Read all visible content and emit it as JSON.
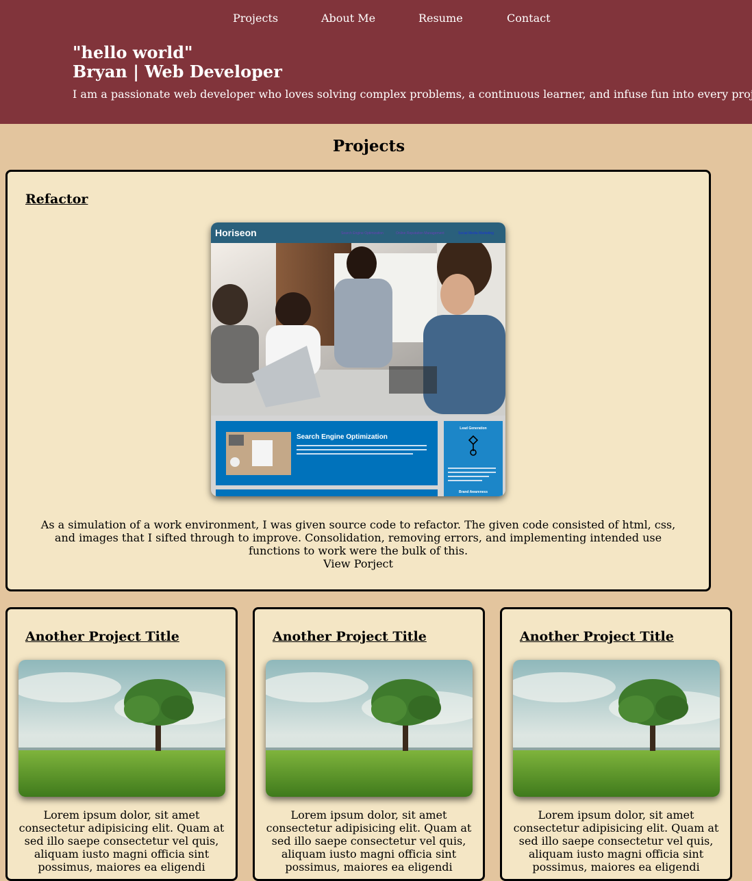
{
  "nav": {
    "items": [
      {
        "label": "Projects"
      },
      {
        "label": "About Me"
      },
      {
        "label": "Resume"
      },
      {
        "label": "Contact"
      }
    ]
  },
  "hero": {
    "greeting": "\"hello world\"",
    "title": "Bryan | Web Developer",
    "intro": "I am a passionate web developer who loves solving complex problems, a continuous learner, and infuse fun into every project."
  },
  "projects_section": {
    "heading": "Projects",
    "featured": {
      "title": "Refactor",
      "description": "As a simulation of a work environment, I was given source code to refactor. The given code consisted of html, css, and images that I sifted through to improve. Consolidation, removing errors, and implementing intended use functions to work were the bulk of this.",
      "link_label": "View Porject",
      "screenshot": {
        "brand": "Horiseon",
        "nav_links": [
          "Search Engine Optimization",
          "Online Reputation Management",
          "Social Media Marketing"
        ],
        "feature_heading": "Search Engine Optimization",
        "feature_text": "The dominance of mobile internet use means that users are searching for the right business as they travel, shop, or sit on their couch at home. Search Engine Optimization (SEO) allows you to increase your visibility and find the right customers for your business.",
        "side_heading": "Lead Generation",
        "side_text": "Inbound strategies for lead generation require less work for your business, bringing customers directly to your website.",
        "side_footer": "Brand Awareness"
      }
    },
    "cards": [
      {
        "title": "Another Project Title",
        "description": "Lorem ipsum dolor, sit amet consectetur adipisicing elit. Quam at sed illo saepe consectetur vel quis, aliquam iusto magni officia sint possimus, maiores ea eligendi"
      },
      {
        "title": "Another Project Title",
        "description": "Lorem ipsum dolor, sit amet consectetur adipisicing elit. Quam at sed illo saepe consectetur vel quis, aliquam iusto magni officia sint possimus, maiores ea eligendi"
      },
      {
        "title": "Another Project Title",
        "description": "Lorem ipsum dolor, sit amet consectetur adipisicing elit. Quam at sed illo saepe consectetur vel quis, aliquam iusto magni officia sint possimus, maiores ea eligendi"
      }
    ]
  },
  "colors": {
    "header_bg": "#81343b",
    "page_bg": "#e3c59e",
    "card_bg": "#f4e6c5",
    "card_border": "#000000"
  }
}
